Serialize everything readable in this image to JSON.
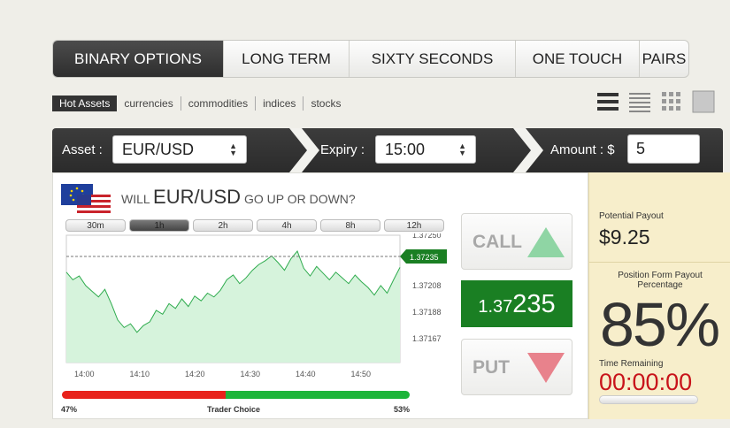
{
  "tabs": [
    "BINARY OPTIONS",
    "LONG TERM",
    "SIXTY SECONDS",
    "ONE TOUCH",
    "PAIRS"
  ],
  "filters": [
    "Hot Assets",
    "currencies",
    "commodities",
    "indices",
    "stocks"
  ],
  "bar": {
    "asset_label": "Asset :",
    "asset_value": "EUR/USD",
    "expiry_label": "Expiry :",
    "expiry_value": "15:00",
    "amount_label": "Amount : $",
    "amount_value": "5"
  },
  "question": {
    "prefix": "WILL",
    "pair": "EUR/USD",
    "suffix": "GO UP OR DOWN?"
  },
  "timeframes": [
    "30m",
    "1h",
    "2h",
    "4h",
    "8h",
    "12h"
  ],
  "active_timeframe": "1h",
  "chart_data": {
    "type": "area",
    "x": [
      "14:00",
      "14:10",
      "14:20",
      "14:30",
      "14:40",
      "14:50"
    ],
    "yticks": [
      "1.37250",
      "1.37235",
      "1.37208",
      "1.37188",
      "1.37167"
    ],
    "ylim": [
      1.3716,
      1.3725
    ],
    "current_price": "1.37235",
    "color": "#2eab4d",
    "fill": "#d6f3dc"
  },
  "call_label": "CALL",
  "put_label": "PUT",
  "price": {
    "small": "1.37",
    "big": "235"
  },
  "sentiment": {
    "red_pct": 47,
    "red_label": "47%",
    "green_label": "53%",
    "label": "Trader Choice"
  },
  "payout": {
    "potential_label": "Potential Payout",
    "potential_value": "$9.25",
    "form_label": "Position Form Payout Percentage",
    "percent": "85%",
    "time_label": "Time Remaining",
    "time_value": "00:00:00"
  },
  "colors": {
    "call": "#8fd5a4",
    "put": "#e8828c",
    "price_bg": "#1a7f23",
    "timer": "#c8141b"
  }
}
